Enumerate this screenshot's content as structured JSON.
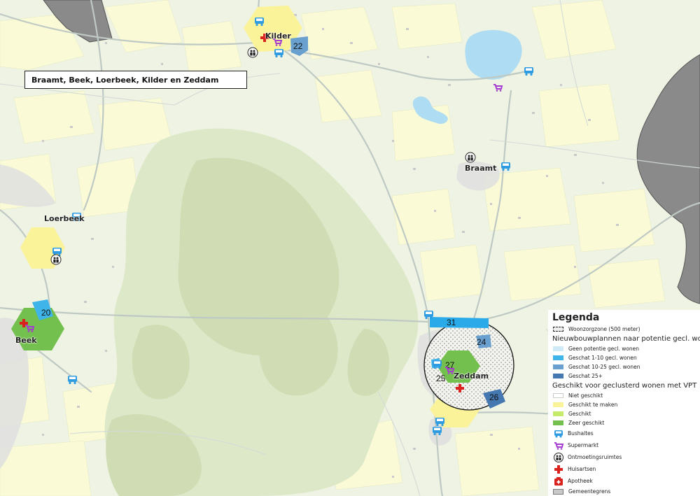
{
  "map_title": "Braamt, Beek, Loerbeek, Kilder en Zeddam",
  "places": {
    "kilder": "Kilder",
    "braamt": "Braamt",
    "loerbeek": "Loerbeek",
    "beek": "Beek",
    "zeddam": "Zeddam"
  },
  "plan_labels": {
    "p20": "20",
    "p22": "22",
    "p24": "24",
    "p25": "25",
    "p26": "26",
    "p27": "27",
    "p31": "31"
  },
  "legend": {
    "title": "Legenda",
    "zone": "Woonzorgzone (500 meter)",
    "plans_heading": "Nieuwbouwplannen naar potentie gecl. wonen",
    "plans": [
      {
        "label": "Geen potentie gecl. wonen",
        "color": "#cfeaf6"
      },
      {
        "label": "Geschat 1-10 gecl. wonen",
        "color": "#3fb4e8"
      },
      {
        "label": "Geschat 10-25 gecl. wonen",
        "color": "#6aa0cf"
      },
      {
        "label": "Geschat 25+",
        "color": "#4577b0"
      }
    ],
    "suit_heading": "Geschikt voor geclusterd wonen met VPT",
    "suit": [
      {
        "label": "Niet geschikt",
        "color": "#ffffff"
      },
      {
        "label": "Geschikt te maken",
        "color": "#fbf39a"
      },
      {
        "label": "Geschikt",
        "color": "#c6ea6a"
      },
      {
        "label": "Zeer geschikt",
        "color": "#74c04e"
      }
    ],
    "symbols": {
      "bus": "Bushaltes",
      "supermarket": "Supermarkt",
      "meeting": "Ontmoetingsruimtes",
      "doctor": "Huisartsen",
      "pharmacy": "Apotheek",
      "border": "Gemeentegrens"
    }
  },
  "colors": {
    "background": "#eef3e3",
    "field_yellow": "#fafbd6",
    "forest_dark": "#cfdcb4",
    "forest_light": "#dde8c9",
    "road": "#bfc9c4",
    "water": "#aedcf2",
    "municipality": "#8a8a8a",
    "bus": "#2f9be0",
    "supermarket": "#a43cd0",
    "doctor": "#d9211e"
  }
}
